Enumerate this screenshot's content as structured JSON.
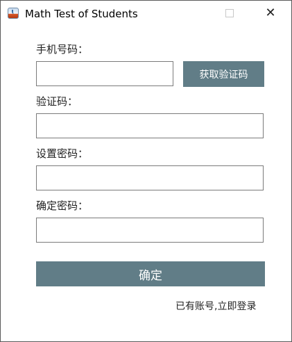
{
  "window": {
    "title": "Math Test of Students",
    "icon": "java-cup-icon",
    "controls": {
      "minimize": "minimize-icon",
      "maximize": "maximize-icon",
      "close": "✕"
    }
  },
  "form": {
    "phone_label": "手机号码：",
    "phone_value": "",
    "get_code_label": "获取验证码",
    "code_label": "验证码：",
    "code_value": "",
    "password_label": "设置密码：",
    "password_value": "",
    "confirm_label": "确定密码：",
    "confirm_value": "",
    "submit_label": "确定",
    "login_link": "已有账号,立即登录"
  },
  "colors": {
    "button_bg": "#617d87",
    "button_text": "#ffffff",
    "field_border": "#7a7a7a"
  }
}
